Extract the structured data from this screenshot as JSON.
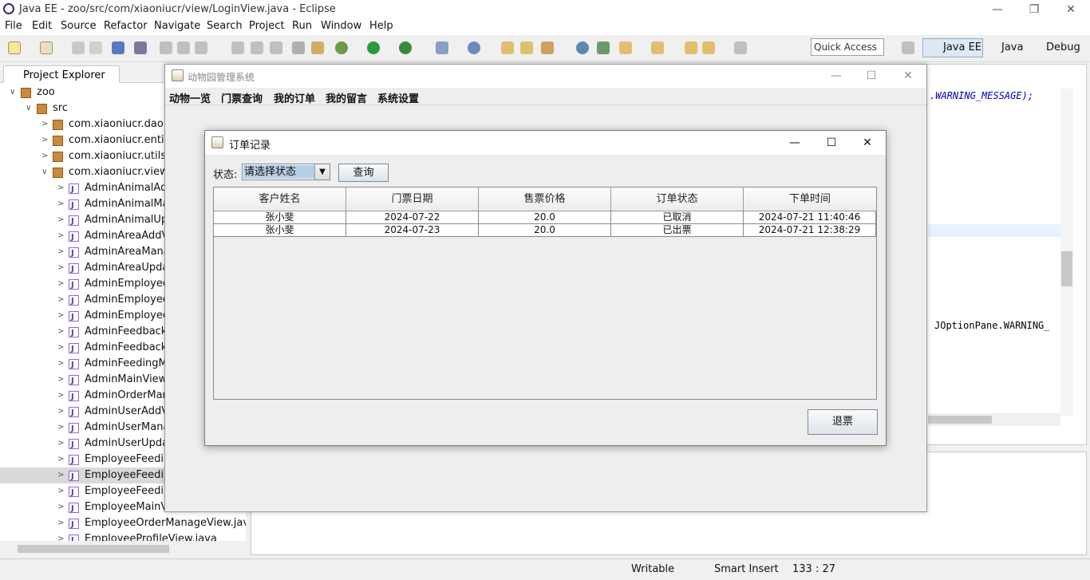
{
  "eclipse": {
    "title": "Java EE - zoo/src/com/xiaoniucr/view/LoginView.java - Eclipse",
    "menu": [
      "File",
      "Edit",
      "Source",
      "Refactor",
      "Navigate",
      "Search",
      "Project",
      "Run",
      "Window",
      "Help"
    ],
    "quick_access": "Quick Access",
    "perspectives": [
      "Java EE",
      "Java",
      "Debug"
    ]
  },
  "explorer": {
    "tab_label": "Project Explorer",
    "items": [
      {
        "label": "zoo",
        "type": "project",
        "indent": 0
      },
      {
        "label": "src",
        "type": "folder",
        "indent": 1
      },
      {
        "label": "com.xiaoniucr.dao",
        "type": "package",
        "indent": 2
      },
      {
        "label": "com.xiaoniucr.entity",
        "type": "package",
        "indent": 2
      },
      {
        "label": "com.xiaoniucr.utils",
        "type": "package",
        "indent": 2
      },
      {
        "label": "com.xiaoniucr.view",
        "type": "package",
        "indent": 2,
        "expanded": true
      },
      {
        "label": "AdminAnimalAdd",
        "type": "java",
        "indent": 3
      },
      {
        "label": "AdminAnimalMar",
        "type": "java",
        "indent": 3
      },
      {
        "label": "AdminAnimalUpd",
        "type": "java",
        "indent": 3
      },
      {
        "label": "AdminAreaAddVi",
        "type": "java",
        "indent": 3
      },
      {
        "label": "AdminAreaManag",
        "type": "java",
        "indent": 3
      },
      {
        "label": "AdminAreaUpdat",
        "type": "java",
        "indent": 3
      },
      {
        "label": "AdminEmployeeA",
        "type": "java",
        "indent": 3
      },
      {
        "label": "AdminEmployeeN",
        "type": "java",
        "indent": 3
      },
      {
        "label": "AdminEmployeeU",
        "type": "java",
        "indent": 3
      },
      {
        "label": "AdminFeedbackM",
        "type": "java",
        "indent": 3
      },
      {
        "label": "AdminFeedbackR",
        "type": "java",
        "indent": 3
      },
      {
        "label": "AdminFeedingMa",
        "type": "java",
        "indent": 3
      },
      {
        "label": "AdminMainView.j",
        "type": "java",
        "indent": 3
      },
      {
        "label": "AdminOrderMana",
        "type": "java",
        "indent": 3
      },
      {
        "label": "AdminUserAddVi",
        "type": "java",
        "indent": 3
      },
      {
        "label": "AdminUserManag",
        "type": "java",
        "indent": 3
      },
      {
        "label": "AdminUserUpdat",
        "type": "java",
        "indent": 3
      },
      {
        "label": "EmployeeFeeding",
        "type": "java",
        "indent": 3
      },
      {
        "label": "EmployeeFeeding",
        "type": "java",
        "indent": 3,
        "selected": true
      },
      {
        "label": "EmployeeFeeding",
        "type": "java",
        "indent": 3
      },
      {
        "label": "EmployeeMainVie",
        "type": "java",
        "indent": 3
      },
      {
        "label": "EmployeeOrderManageView.jav",
        "type": "java",
        "indent": 3
      },
      {
        "label": "EmployeeProfileView.java",
        "type": "java",
        "indent": 3
      }
    ]
  },
  "editor": {
    "line1": ".WARNING_MESSAGE);",
    "line2": "JOptionPane.WARNING_"
  },
  "statusbar": {
    "writable": "Writable",
    "insert": "Smart Insert",
    "position": "133 : 27"
  },
  "main_window": {
    "title": "动物园管理系统",
    "menu": [
      "动物一览",
      "门票查询",
      "我的订单",
      "我的留言",
      "系统设置"
    ]
  },
  "dialog": {
    "title": "订单记录",
    "status_label": "状态:",
    "status_value": "请选择状态",
    "query_button": "查询",
    "refund_button": "退票",
    "columns": [
      "客户姓名",
      "门票日期",
      "售票价格",
      "订单状态",
      "下单时间"
    ],
    "rows": [
      [
        "张小斐",
        "2024-07-22",
        "20.0",
        "已取消",
        "2024-07-21 11:40:46"
      ],
      [
        "张小斐",
        "2024-07-23",
        "20.0",
        "已出票",
        "2024-07-21 12:38:29"
      ]
    ]
  }
}
